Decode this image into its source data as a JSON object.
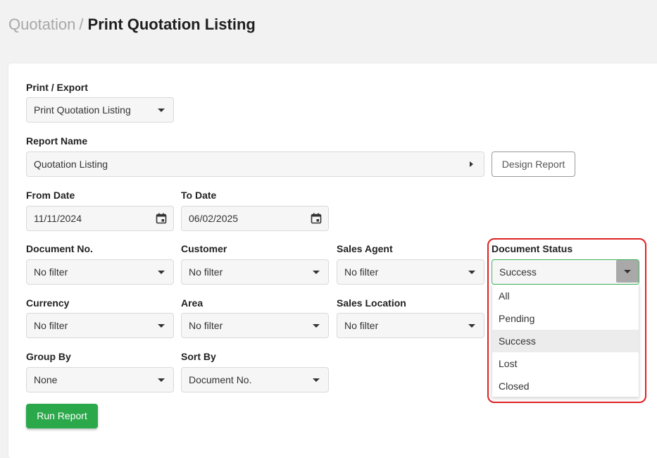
{
  "breadcrumb": {
    "parent": "Quotation",
    "separator": "/",
    "current": "Print Quotation Listing"
  },
  "print_export": {
    "label": "Print / Export",
    "value": "Print Quotation Listing"
  },
  "report_name": {
    "label": "Report Name",
    "value": "Quotation Listing",
    "design_button": "Design Report"
  },
  "from_date": {
    "label": "From Date",
    "value": "11/11/2024",
    "icon": "calendar-icon"
  },
  "to_date": {
    "label": "To Date",
    "value": "06/02/2025",
    "icon": "calendar-icon"
  },
  "document_no": {
    "label": "Document No.",
    "value": "No filter"
  },
  "customer": {
    "label": "Customer",
    "value": "No filter"
  },
  "sales_agent": {
    "label": "Sales Agent",
    "value": "No filter"
  },
  "document_status": {
    "label": "Document Status",
    "value": "Success",
    "options": [
      "All",
      "Pending",
      "Success",
      "Lost",
      "Closed"
    ]
  },
  "currency": {
    "label": "Currency",
    "value": "No filter"
  },
  "area": {
    "label": "Area",
    "value": "No filter"
  },
  "sales_location": {
    "label": "Sales Location",
    "value": "No filter"
  },
  "group_by": {
    "label": "Group By",
    "value": "None"
  },
  "sort_by": {
    "label": "Sort By",
    "value": "Document No."
  },
  "run_button": "Run Report",
  "colors": {
    "accent_green": "#2aa84a",
    "focus_border": "#3db45b",
    "highlight_red": "#e02020"
  }
}
